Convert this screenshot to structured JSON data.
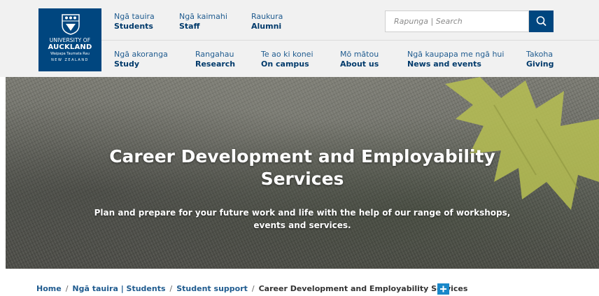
{
  "logo": {
    "line1": "UNIVERSITY OF",
    "line2": "AUCKLAND",
    "line3": "Waipapa Taumata Rau",
    "line4": "NEW ZEALAND"
  },
  "topnav": [
    {
      "maori": "Ngā tauira",
      "english": "Students"
    },
    {
      "maori": "Ngā kaimahi",
      "english": "Staff"
    },
    {
      "maori": "Raukura",
      "english": "Alumni"
    }
  ],
  "mainnav": [
    {
      "maori": "Ngā akoranga",
      "english": "Study"
    },
    {
      "maori": "Rangahau",
      "english": "Research"
    },
    {
      "maori": "Te ao ki konei",
      "english": "On campus"
    },
    {
      "maori": "Mō mātou",
      "english": "About us"
    },
    {
      "maori": "Ngā kaupapa me ngā hui",
      "english": "News and events"
    },
    {
      "maori": "Takoha",
      "english": "Giving"
    }
  ],
  "search": {
    "placeholder": "Rapunga | Search",
    "button_icon": "search-icon"
  },
  "hero": {
    "title": "Career Development and Employability Services",
    "subtitle": "Plan and prepare for your future work and life with the help of our range of workshops, events and services."
  },
  "breadcrumb": {
    "items": [
      "Home",
      "Ngā tauira | Students",
      "Student support"
    ],
    "separator": "/",
    "current": "Career Development and Employability Services",
    "expand_icon": "plus-icon"
  },
  "colors": {
    "brand": "#00467f",
    "link": "#1f5b8f",
    "accent": "#1a88c9"
  }
}
